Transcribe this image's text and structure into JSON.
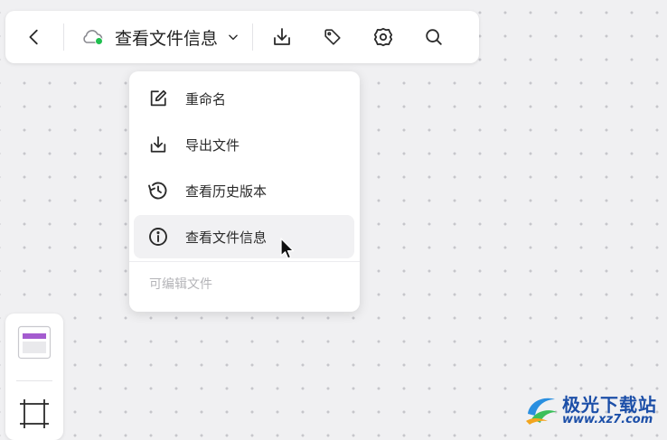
{
  "toolbar": {
    "file_title": "查看文件信息",
    "cloud_status_color": "#1fbf4f",
    "icons": [
      "chevron-left-icon",
      "cloud-icon",
      "chevron-down-icon",
      "download-icon",
      "tag-icon",
      "gear-icon",
      "search-icon"
    ]
  },
  "menu": {
    "items": [
      {
        "label": "重命名",
        "icon": "edit-icon"
      },
      {
        "label": "导出文件",
        "icon": "export-icon"
      },
      {
        "label": "查看历史版本",
        "icon": "history-icon"
      },
      {
        "label": "查看文件信息",
        "icon": "info-icon",
        "hovered": true
      }
    ],
    "caption": "可编辑文件"
  },
  "side_panel": {
    "icons": [
      "template-icon",
      "frame-icon"
    ]
  },
  "watermark": {
    "name": "极光下载站",
    "url": "www.xz7.com"
  },
  "colors": {
    "canvas_bg": "#f0f0f2",
    "accent_green": "#1fbf4f",
    "template_purple": "#a45ccf",
    "watermark_blue": "#1c4fa8"
  }
}
